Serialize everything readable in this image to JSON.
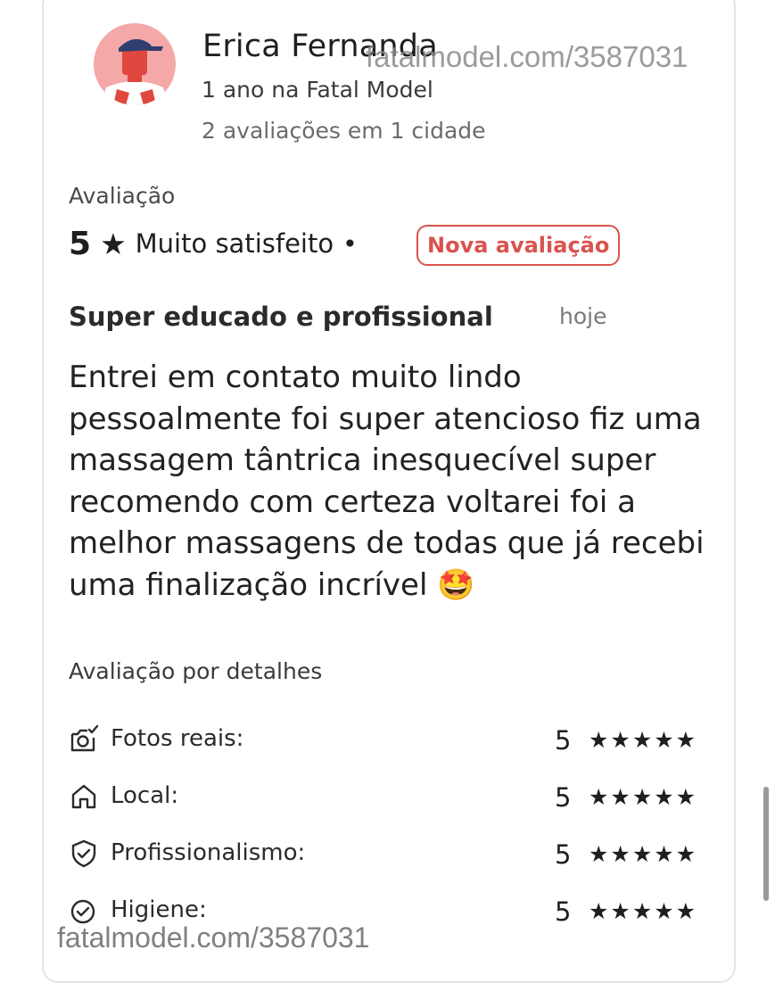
{
  "user": {
    "name": "Erica Fernanda",
    "tenure": "1 ano na Fatal Model",
    "reviews_summary": "2 avaliações em 1 cidade"
  },
  "watermark": {
    "top": "fatalmodel.com/3587031",
    "bottom": "fatalmodel.com/3587031"
  },
  "review": {
    "section_label": "Avaliação",
    "score": "5",
    "star": "★",
    "satisfaction": "Muito satisfeito",
    "separator": "•",
    "badge": "Nova avaliação",
    "title": "Super educado e profissional",
    "date": "hoje",
    "body": "Entrei em contato muito lindo pessoalmente foi super atencioso fiz uma massagem tântrica inesquecível super recomendo com certeza voltarei foi a melhor massagens de todas que já recebi uma finalização incrível 🤩"
  },
  "details": {
    "label": "Avaliação por detalhes",
    "items": [
      {
        "label": "Fotos reais:",
        "score": "5",
        "stars": "★★★★★",
        "icon": "camera-check-icon"
      },
      {
        "label": "Local:",
        "score": "5",
        "stars": "★★★★★",
        "icon": "home-icon"
      },
      {
        "label": "Profissionalismo:",
        "score": "5",
        "stars": "★★★★★",
        "icon": "shield-check-icon"
      },
      {
        "label": "Higiene:",
        "score": "5",
        "stars": "★★★★★",
        "icon": "check-circle-icon"
      }
    ]
  },
  "colors": {
    "badge": "#d9534f",
    "avatar_bg": "#f4a8a8",
    "text": "#1f1f1f"
  }
}
